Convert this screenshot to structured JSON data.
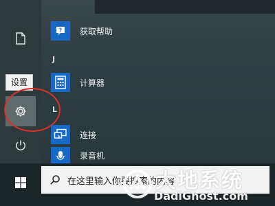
{
  "start_menu": {
    "tooltip": "设置",
    "rail_items": [
      {
        "icon": "document-icon"
      },
      {
        "icon": "gear-icon"
      },
      {
        "icon": "power-icon"
      }
    ],
    "sections": [
      {
        "letter": "J"
      },
      {
        "letter": "L"
      }
    ],
    "apps": [
      {
        "label": "获取帮助",
        "icon": "help-icon"
      },
      {
        "label": "计算器",
        "icon": "calculator-icon"
      },
      {
        "label": "连接",
        "icon": "connect-icon"
      },
      {
        "label": "录音机",
        "icon": "microphone-icon"
      }
    ]
  },
  "taskbar": {
    "search_placeholder": "在这里输入你要搜索的内容"
  },
  "watermark": {
    "brand": "大地系统",
    "url": "DadiGhost.com"
  },
  "colors": {
    "tile_blue": "#1769c7",
    "highlight_ring": "#d9302c"
  }
}
